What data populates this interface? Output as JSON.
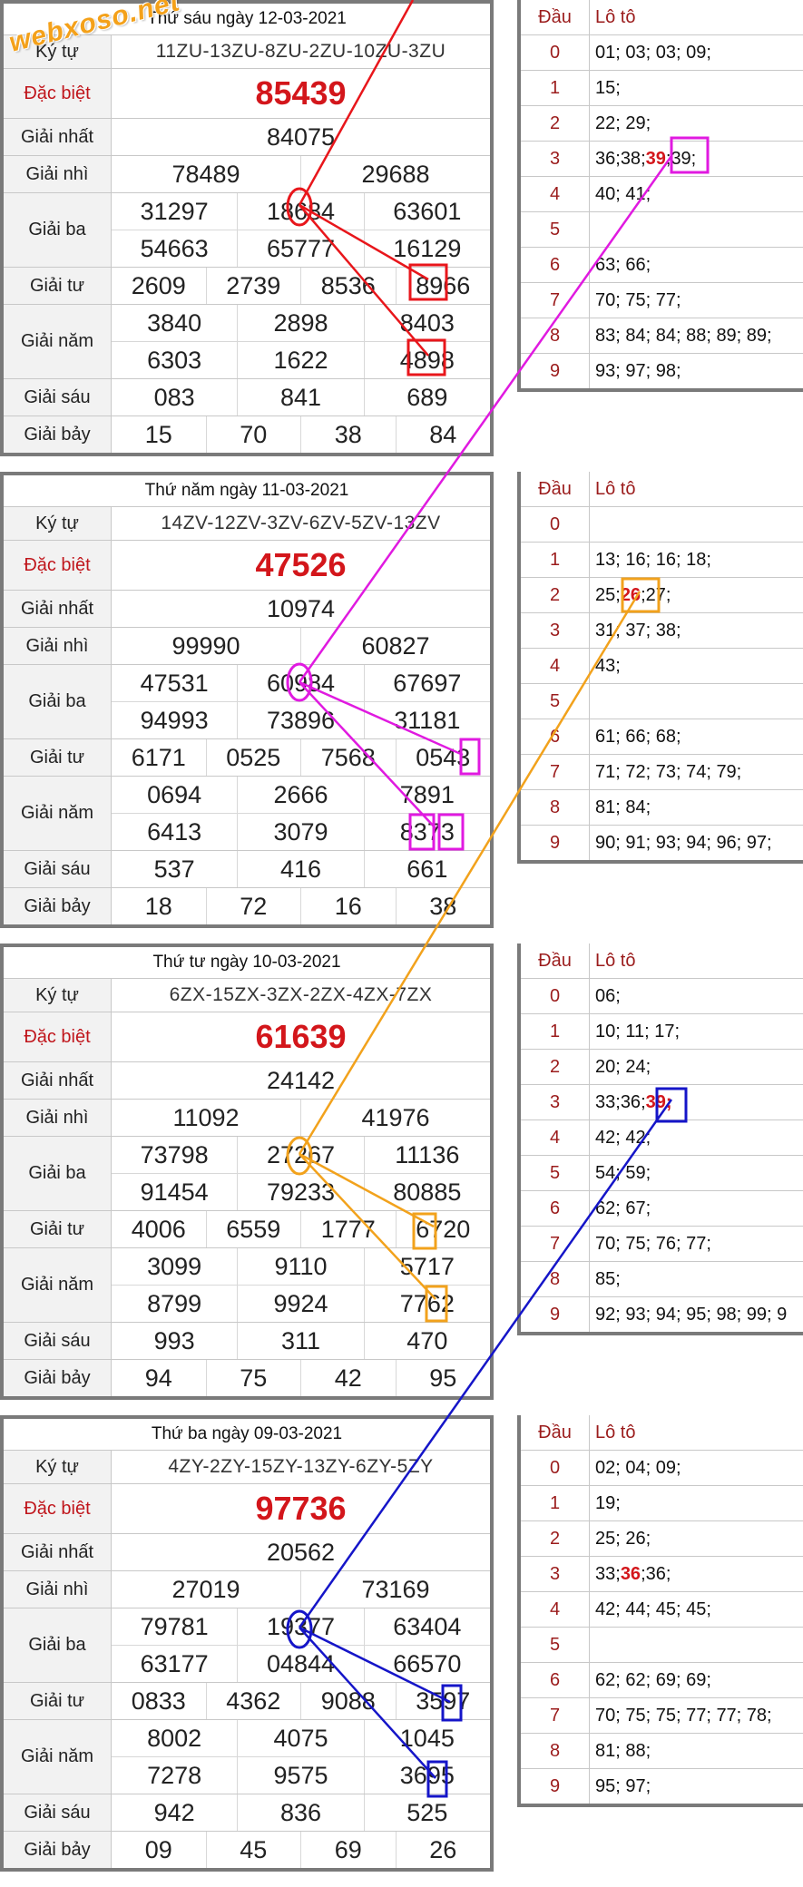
{
  "watermark": "webxoso.net",
  "days": [
    {
      "title": "Thứ sáu ngày 12-03-2021",
      "ky_tu_label": "Ký tự",
      "ky_tu": "11ZU-13ZU-8ZU-2ZU-10ZU-3ZU",
      "dac_biet_label": "Đặc biệt",
      "dac_biet": "85439",
      "nhat_label": "Giải nhất",
      "nhat": [
        "84075"
      ],
      "nhi_label": "Giải nhì",
      "nhi": [
        "78489",
        "29688"
      ],
      "ba_label": "Giải ba",
      "ba": [
        [
          "31297",
          "18684",
          "63601"
        ],
        [
          "54663",
          "65777",
          "16129"
        ]
      ],
      "tu_label": "Giải tư",
      "tu": [
        "2609",
        "2739",
        "8536",
        "8966"
      ],
      "nam_label": "Giải năm",
      "nam": [
        [
          "3840",
          "2898",
          "8403"
        ],
        [
          "6303",
          "1622",
          "4898"
        ]
      ],
      "sau_label": "Giải sáu",
      "sau": [
        "083",
        "841",
        "689"
      ],
      "bay_label": "Giải bảy",
      "bay": [
        "15",
        "70",
        "38",
        "84"
      ],
      "loto_head": "Đầu",
      "loto_title": "Lô tô",
      "loto": [
        {
          "d": "0",
          "v": "01; 03; 03; 09;"
        },
        {
          "d": "1",
          "v": "15;"
        },
        {
          "d": "2",
          "v": "22; 29;"
        },
        {
          "d": "3",
          "v": "36; 38; 39; 39;",
          "hi": "39"
        },
        {
          "d": "4",
          "v": "40; 41;"
        },
        {
          "d": "5",
          "v": ""
        },
        {
          "d": "6",
          "v": "63; 66;"
        },
        {
          "d": "7",
          "v": "70; 75; 77;"
        },
        {
          "d": "8",
          "v": "83; 84; 84; 88; 89; 89;"
        },
        {
          "d": "9",
          "v": "93; 97; 98;"
        }
      ]
    },
    {
      "title": "Thứ năm ngày 11-03-2021",
      "ky_tu_label": "Ký tự",
      "ky_tu": "14ZV-12ZV-3ZV-6ZV-5ZV-13ZV",
      "dac_biet_label": "Đặc biệt",
      "dac_biet": "47526",
      "nhat_label": "Giải nhất",
      "nhat": [
        "10974"
      ],
      "nhi_label": "Giải nhì",
      "nhi": [
        "99990",
        "60827"
      ],
      "ba_label": "Giải ba",
      "ba": [
        [
          "47531",
          "60984",
          "67697"
        ],
        [
          "94993",
          "73896",
          "31181"
        ]
      ],
      "tu_label": "Giải tư",
      "tu": [
        "6171",
        "0525",
        "7568",
        "0543"
      ],
      "nam_label": "Giải năm",
      "nam": [
        [
          "0694",
          "2666",
          "7891"
        ],
        [
          "6413",
          "3079",
          "8373"
        ]
      ],
      "sau_label": "Giải sáu",
      "sau": [
        "537",
        "416",
        "661"
      ],
      "bay_label": "Giải bảy",
      "bay": [
        "18",
        "72",
        "16",
        "38"
      ],
      "loto_head": "Đầu",
      "loto_title": "Lô tô",
      "loto": [
        {
          "d": "0",
          "v": ""
        },
        {
          "d": "1",
          "v": "13; 16; 16; 18;"
        },
        {
          "d": "2",
          "v": "25; 26; 27;",
          "hi": "26"
        },
        {
          "d": "3",
          "v": "31; 37; 38;"
        },
        {
          "d": "4",
          "v": "43;"
        },
        {
          "d": "5",
          "v": ""
        },
        {
          "d": "6",
          "v": "61; 66; 68;"
        },
        {
          "d": "7",
          "v": "71; 72; 73; 74; 79;"
        },
        {
          "d": "8",
          "v": "81; 84;"
        },
        {
          "d": "9",
          "v": "90; 91; 93; 94; 96; 97;"
        }
      ]
    },
    {
      "title": "Thứ tư ngày 10-03-2021",
      "ky_tu_label": "Ký tự",
      "ky_tu": "6ZX-15ZX-3ZX-2ZX-4ZX-7ZX",
      "dac_biet_label": "Đặc biệt",
      "dac_biet": "61639",
      "nhat_label": "Giải nhất",
      "nhat": [
        "24142"
      ],
      "nhi_label": "Giải nhì",
      "nhi": [
        "11092",
        "41976"
      ],
      "ba_label": "Giải ba",
      "ba": [
        [
          "73798",
          "27267",
          "11136"
        ],
        [
          "91454",
          "79233",
          "80885"
        ]
      ],
      "tu_label": "Giải tư",
      "tu": [
        "4006",
        "6559",
        "1777",
        "6720"
      ],
      "nam_label": "Giải năm",
      "nam": [
        [
          "3099",
          "9110",
          "5717"
        ],
        [
          "8799",
          "9924",
          "7762"
        ]
      ],
      "sau_label": "Giải sáu",
      "sau": [
        "993",
        "311",
        "470"
      ],
      "bay_label": "Giải bảy",
      "bay": [
        "94",
        "75",
        "42",
        "95"
      ],
      "loto_head": "Đầu",
      "loto_title": "Lô tô",
      "loto": [
        {
          "d": "0",
          "v": "06;"
        },
        {
          "d": "1",
          "v": "10; 11; 17;"
        },
        {
          "d": "2",
          "v": "20; 24;"
        },
        {
          "d": "3",
          "v": "33; 36; 39;",
          "hi": "39"
        },
        {
          "d": "4",
          "v": "42; 42;"
        },
        {
          "d": "5",
          "v": "54; 59;"
        },
        {
          "d": "6",
          "v": "62; 67;"
        },
        {
          "d": "7",
          "v": "70; 75; 76; 77;"
        },
        {
          "d": "8",
          "v": "85;"
        },
        {
          "d": "9",
          "v": "92; 93; 94; 95; 98; 99; 9"
        }
      ]
    },
    {
      "title": "Thứ ba ngày 09-03-2021",
      "ky_tu_label": "Ký tự",
      "ky_tu": "4ZY-2ZY-15ZY-13ZY-6ZY-5ZY",
      "dac_biet_label": "Đặc biệt",
      "dac_biet": "97736",
      "nhat_label": "Giải nhất",
      "nhat": [
        "20562"
      ],
      "nhi_label": "Giải nhì",
      "nhi": [
        "27019",
        "73169"
      ],
      "ba_label": "Giải ba",
      "ba": [
        [
          "79781",
          "19377",
          "63404"
        ],
        [
          "63177",
          "04844",
          "66570"
        ]
      ],
      "tu_label": "Giải tư",
      "tu": [
        "0833",
        "4362",
        "9088",
        "3597"
      ],
      "nam_label": "Giải năm",
      "nam": [
        [
          "8002",
          "4075",
          "1045"
        ],
        [
          "7278",
          "9575",
          "3695"
        ]
      ],
      "sau_label": "Giải sáu",
      "sau": [
        "942",
        "836",
        "525"
      ],
      "bay_label": "Giải bảy",
      "bay": [
        "09",
        "45",
        "69",
        "26"
      ],
      "loto_head": "Đầu",
      "loto_title": "Lô tô",
      "loto": [
        {
          "d": "0",
          "v": "02; 04; 09;"
        },
        {
          "d": "1",
          "v": "19;"
        },
        {
          "d": "2",
          "v": "25; 26;"
        },
        {
          "d": "3",
          "v": "33; 36; 36;",
          "hi": "36"
        },
        {
          "d": "4",
          "v": "42; 44; 45; 45;"
        },
        {
          "d": "5",
          "v": ""
        },
        {
          "d": "6",
          "v": "62; 62; 69; 69;"
        },
        {
          "d": "7",
          "v": "70; 75; 75; 77; 77; 78;"
        },
        {
          "d": "8",
          "v": "81; 88;"
        },
        {
          "d": "9",
          "v": "95; 97;"
        }
      ]
    }
  ],
  "colors": {
    "red": "#e8161b",
    "magenta": "#e01ae0",
    "orange": "#f2a21c",
    "blue": "#1515c8"
  }
}
